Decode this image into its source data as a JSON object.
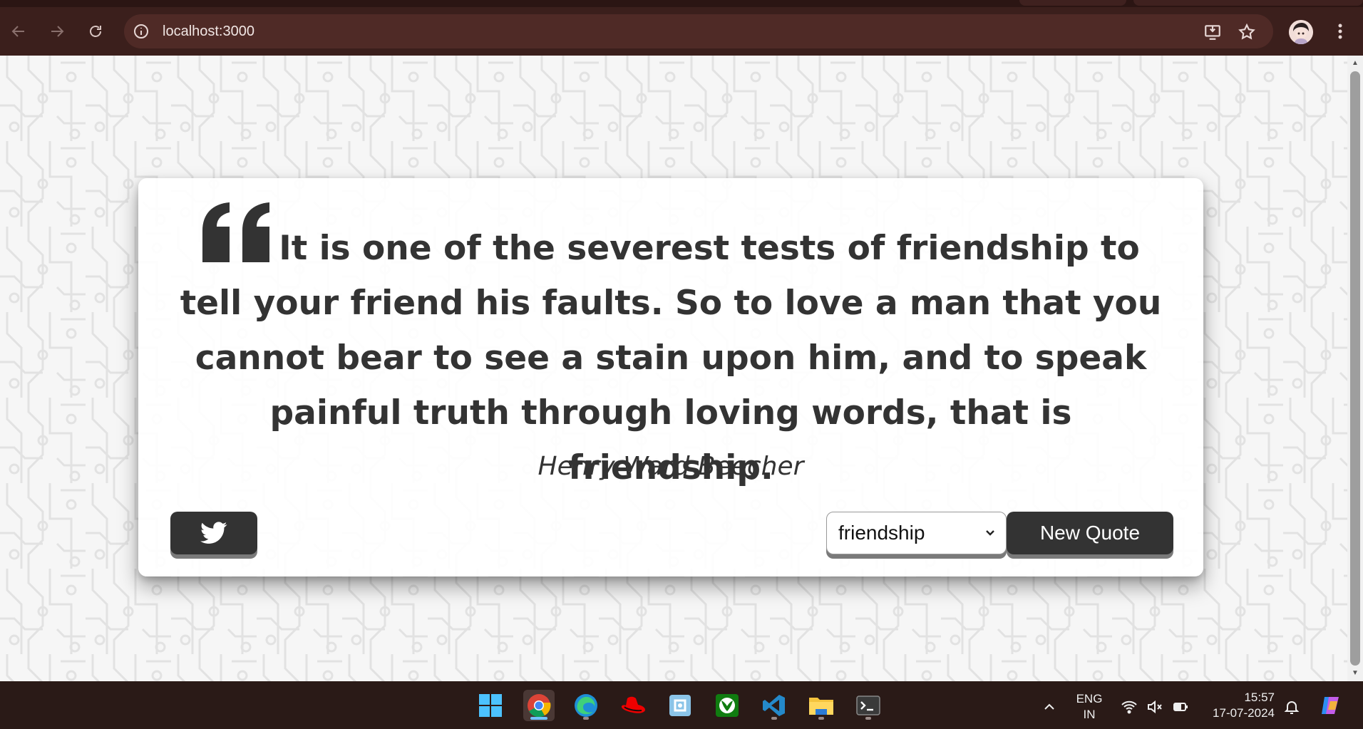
{
  "browser": {
    "url": "localhost:3000",
    "back_icon": "arrow-left-icon",
    "forward_icon": "arrow-right-icon",
    "reload_icon": "reload-icon",
    "site_info_icon": "info-icon",
    "install_icon": "install-app-icon",
    "bookmark_icon": "star-icon",
    "menu_icon": "kebab-menu-icon"
  },
  "quote": {
    "text": "It is one of the severest tests of friendship to tell your friend his faults. So to love a man that you cannot bear to see a stain upon him, and to speak painful truth through loving words, that is friendship.",
    "author": "Henry Ward Beecher",
    "quote_icon": "quote-left-icon"
  },
  "controls": {
    "tweet_icon": "twitter-icon",
    "category_selected": "friendship",
    "new_quote_label": "New Quote"
  },
  "taskbar": {
    "apps": [
      "windows-start",
      "chrome",
      "edge",
      "redhat",
      "notepad",
      "xbox",
      "vscode",
      "file-explorer",
      "terminal"
    ],
    "language_line1": "ENG",
    "language_line2": "IN",
    "time": "15:57",
    "date": "17-07-2024"
  },
  "colors": {
    "chrome_bg": "#3b1f1c",
    "omnibox_bg": "#4f2a26",
    "card_text": "#333333",
    "button_bg": "#333333",
    "taskbar_bg": "#2a1a17"
  }
}
